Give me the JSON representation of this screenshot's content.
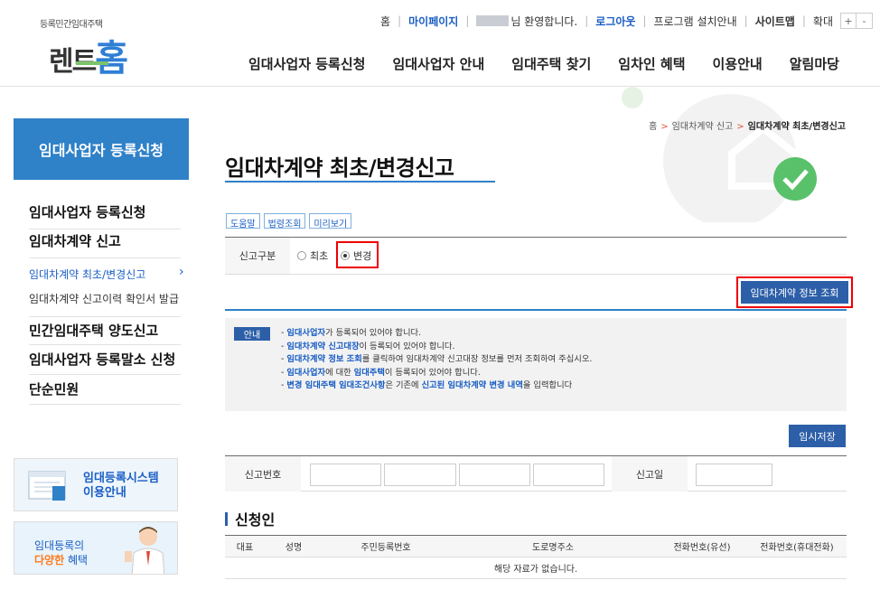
{
  "header": {
    "logo_sub": "등록민간임대주택",
    "logo_main_a": "렌트",
    "logo_main_b": "홈",
    "util": {
      "home": "홈",
      "mypage": "마이페이지",
      "welcome": "님 환영합니다.",
      "logout": "로그아웃",
      "install": "프로그램 설치안내",
      "sitemap": "사이트맵",
      "zoom_label": "확대",
      "zoom_in": "+",
      "zoom_out": "-"
    },
    "gnb": [
      "임대사업자 등록신청",
      "임대사업자 안내",
      "임대주택 찾기",
      "임차인 혜택",
      "이용안내",
      "알림마당"
    ]
  },
  "sidebar": {
    "title": "임대사업자 등록신청",
    "items": [
      "임대사업자 등록신청",
      "임대차계약 신고"
    ],
    "sub_items": [
      "임대차계약 최초/변경신고",
      "임대차계약 신고이력 확인서 발급"
    ],
    "items2": [
      "민간임대주택 양도신고",
      "임대사업자 등록말소 신청",
      "단순민원"
    ],
    "banner1": {
      "line1": "임대등록시스템",
      "line2": "이용안내"
    },
    "banner2": {
      "line1": "임대등록의",
      "line2_a": "다양한",
      "line2_b": " 혜택"
    }
  },
  "breadcrumb": {
    "home": "홈",
    "level1": "임대차계약 신고",
    "current": "임대차계약 최초/변경신고"
  },
  "page_title": "임대차계약 최초/변경신고",
  "small_buttons": [
    "도움말",
    "법령조회",
    "미리보기"
  ],
  "report_type": {
    "label": "신고구분",
    "options": [
      "최초",
      "변경"
    ],
    "selected": "변경"
  },
  "query_button": "임대차계약 정보 조회",
  "notice": {
    "badge": "안내",
    "lines": [
      {
        "hl": "임대사업자",
        "rest": "가 등록되어 있어야 합니다."
      },
      {
        "hl": "임대차계약 신고대장",
        "rest": "이 등록되어 있어야 합니다."
      },
      {
        "hl": "임대차계약 정보 조회",
        "rest": "를 클릭하여 임대차계약 신고대장 정보를 먼저 조회하여 주십시오."
      },
      {
        "hl": "임대사업자",
        "rest": "에 대한 ",
        "hl2": "임대주택",
        "rest2": "이 등록되어 있어야 합니다."
      },
      {
        "hl": "변경 임대주택 임대조건사항",
        "rest": "은 기존에 ",
        "hl2": "신고된 임대차계약 변경 내역",
        "rest2": "을 입력합니다"
      }
    ]
  },
  "save_button": "임시저장",
  "report_number": {
    "label": "신고번호",
    "date_label": "신고일",
    "parts": [
      "",
      "",
      "",
      ""
    ],
    "date": ""
  },
  "applicant": {
    "title": "신청인",
    "columns": [
      "대표",
      "성명",
      "주민등록번호",
      "도로명주소",
      "전화번호(유선)",
      "전화번호(휴대전화)"
    ],
    "empty_message": "해당 자료가 없습니다."
  }
}
